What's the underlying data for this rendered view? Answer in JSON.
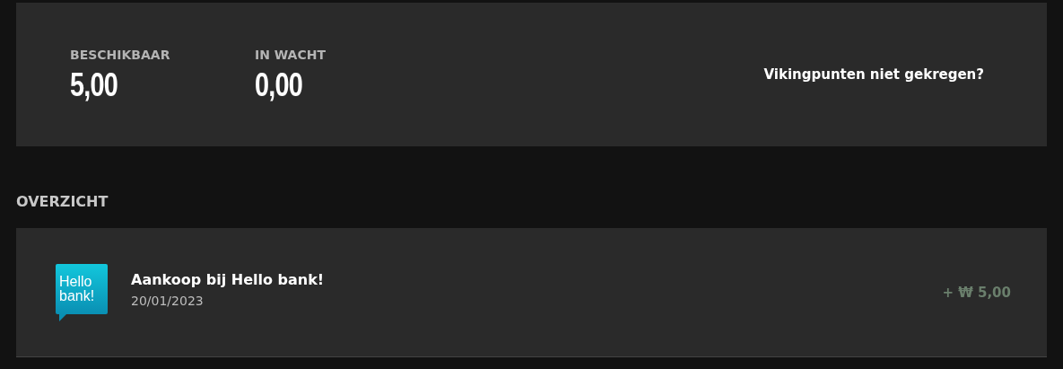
{
  "balances": [
    {
      "label": "BESCHIKBAAR",
      "value": "5,00"
    },
    {
      "label": "IN WACHT",
      "value": "0,00"
    }
  ],
  "help_link": "Vikingpunten niet gekregen?",
  "overview": {
    "heading": "OVERZICHT",
    "transactions": [
      {
        "logo_lines": [
          "Hello",
          "bank!"
        ],
        "title": "Aankoop bij Hello bank!",
        "date": "20/01/2023",
        "amount": "+ ₩ 5,00"
      }
    ]
  }
}
